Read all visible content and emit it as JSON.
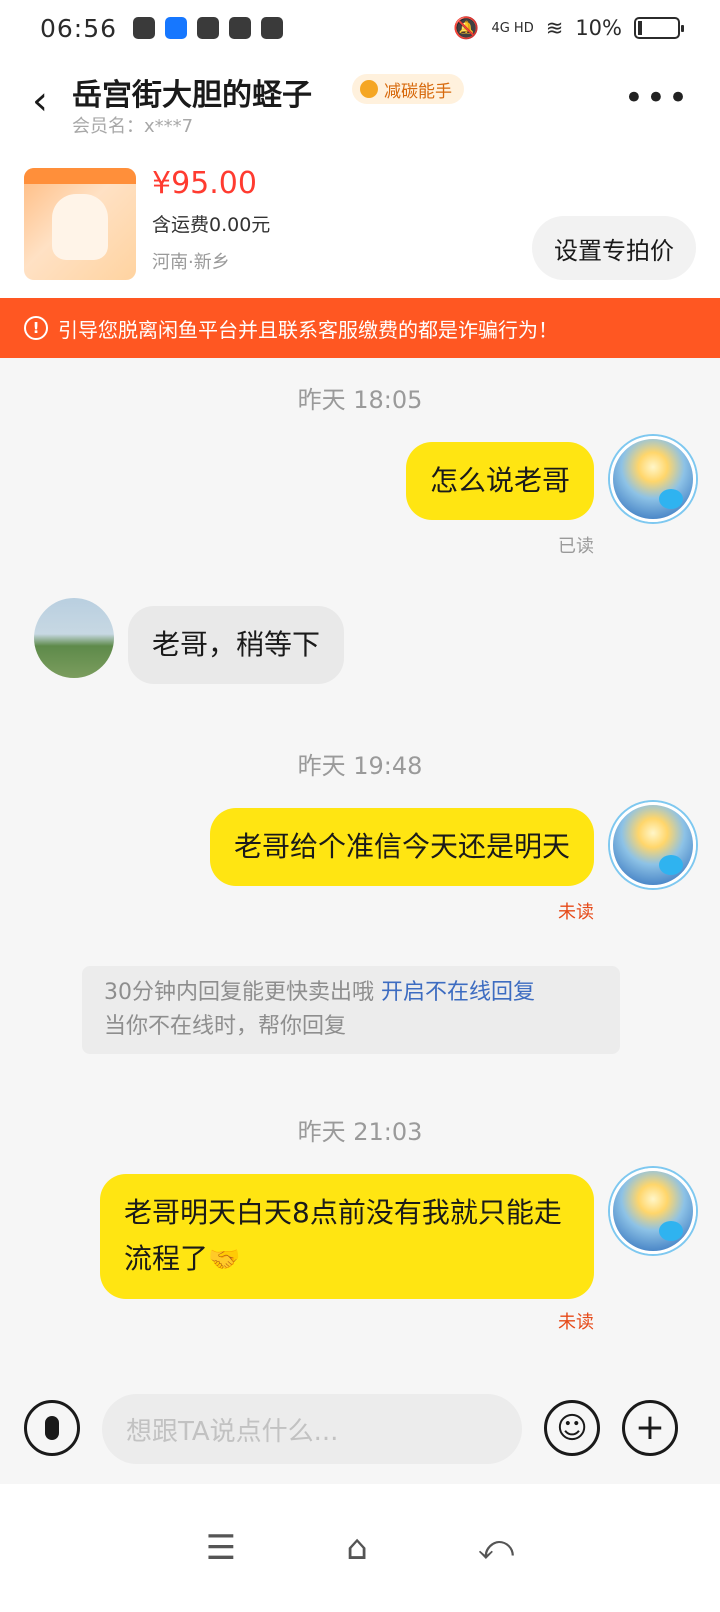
{
  "status_bar": {
    "time": "06:56",
    "network": "4G HD",
    "battery_text": "10%",
    "battery_level": 0.1
  },
  "header": {
    "back_icon": "chevron-left-icon",
    "title": "岳宫街大胆的蛏子",
    "badge": "减碳能手",
    "member": "会员名：x***7",
    "more_icon": "more-dots-icon"
  },
  "product": {
    "price": "¥95.00",
    "shipping": "含运费0.00元",
    "location": "河南·新乡",
    "set_price_button": "设置专拍价"
  },
  "warning": {
    "text": "引导您脱离闲鱼平台并且联系客服缴费的都是诈骗行为！"
  },
  "chat": {
    "time1": "昨天 18:05",
    "msg1": "怎么说老哥",
    "msg1_status": "已读",
    "msg2": "老哥，稍等下",
    "time2": "昨天 19:48",
    "msg3": "老哥给个准信今天还是明天",
    "msg3_status": "未读",
    "notice_text": "30分钟内回复能更快卖出哦",
    "notice_link": "开启不在线回复",
    "notice_sub": "当你不在线时，帮你回复",
    "time3": "昨天 21:03",
    "msg4": "老哥明天白天8点前没有我就只能走流程了",
    "msg4_emoji": "🤝",
    "msg4_status": "未读"
  },
  "input": {
    "placeholder": "想跟TA说点什么..."
  },
  "colors": {
    "accent_yellow": "#ffe512",
    "warning_bg": "#ff5722",
    "price_red": "#ff3b30"
  }
}
